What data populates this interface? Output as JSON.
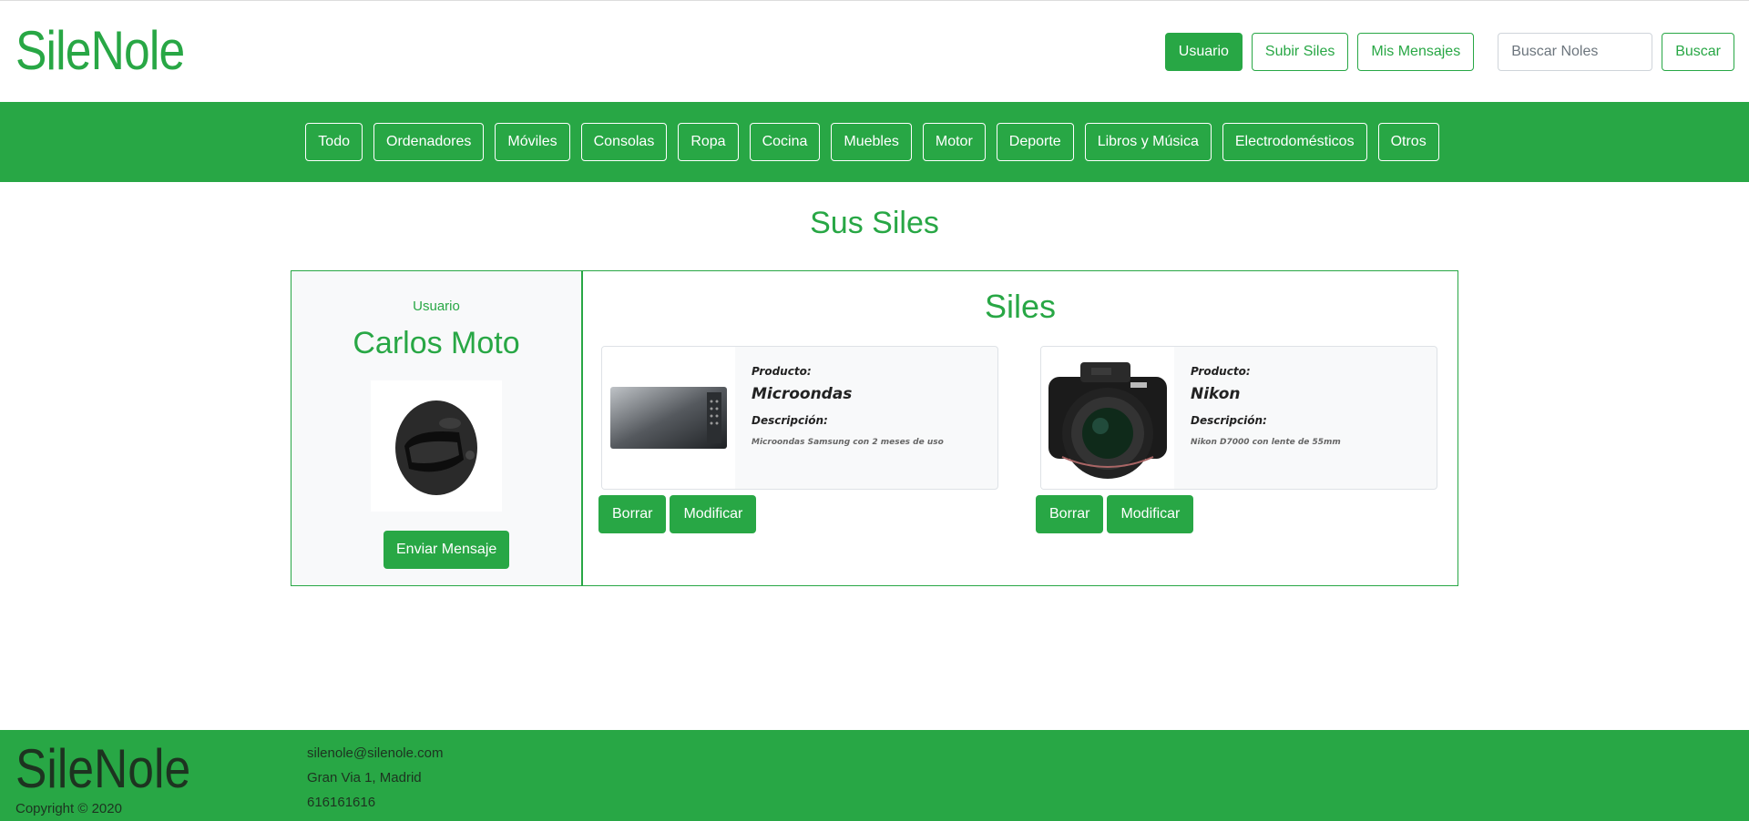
{
  "brand": {
    "name": "SileNole"
  },
  "topnav": {
    "usuario": "Usuario",
    "subir": "Subir Siles",
    "mensajes": "Mis Mensajes",
    "search_placeholder": "Buscar Noles",
    "buscar": "Buscar"
  },
  "categories": [
    "Todo",
    "Ordenadores",
    "Móviles",
    "Consolas",
    "Ropa",
    "Cocina",
    "Muebles",
    "Motor",
    "Deporte",
    "Libros y Música",
    "Electrodomésticos",
    "Otros"
  ],
  "main": {
    "title": "Sus Siles"
  },
  "user": {
    "label": "Usuario",
    "name": "Carlos Moto",
    "message_button": "Enviar Mensaje"
  },
  "items": {
    "title": "Siles",
    "list": [
      {
        "product_label": "Producto:",
        "name": "Microondas",
        "desc_label": "Descripción:",
        "description": "Microondas Samsung con 2 meses de uso",
        "delete": "Borrar",
        "edit": "Modificar"
      },
      {
        "product_label": "Producto:",
        "name": "Nikon",
        "desc_label": "Descripción:",
        "description": "Nikon D7000 con lente de 55mm",
        "delete": "Borrar",
        "edit": "Modificar"
      }
    ]
  },
  "footer": {
    "brand": "SileNole",
    "copyright": "Copyright © 2020",
    "email": "silenole@silenole.com",
    "address": "Gran Via 1, Madrid",
    "phone": "616161616"
  },
  "colors": {
    "accent": "#28a745",
    "footer_text": "#1d3320"
  }
}
